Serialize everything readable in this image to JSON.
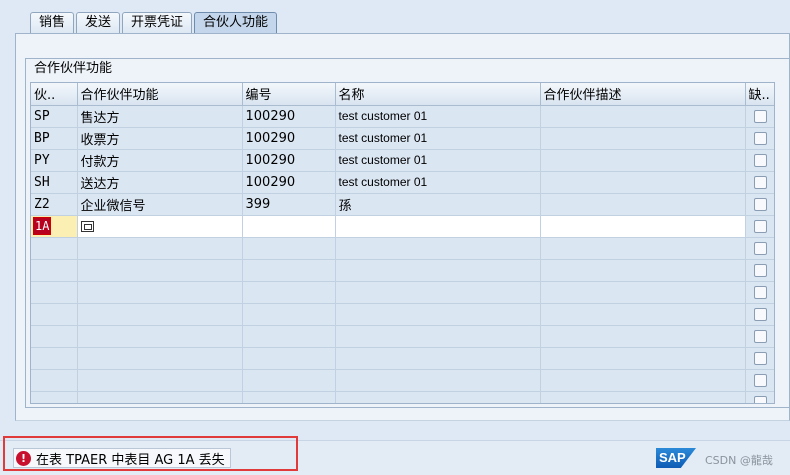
{
  "tabs": [
    {
      "label": "销售"
    },
    {
      "label": "发送"
    },
    {
      "label": "开票凭证"
    },
    {
      "label": "合伙人功能"
    }
  ],
  "group": {
    "title": "合作伙伴功能"
  },
  "table": {
    "headers": [
      "伙..",
      "合作伙伴功能",
      "编号",
      "名称",
      "合作伙伴描述",
      "缺.."
    ],
    "rows": [
      {
        "code": "SP",
        "function": "售达方",
        "number": "100290",
        "name": "test customer 01",
        "desc": ""
      },
      {
        "code": "BP",
        "function": "收票方",
        "number": "100290",
        "name": "test customer 01",
        "desc": ""
      },
      {
        "code": "PY",
        "function": "付款方",
        "number": "100290",
        "name": "test customer 01",
        "desc": ""
      },
      {
        "code": "SH",
        "function": "送达方",
        "number": "100290",
        "name": "test customer 01",
        "desc": ""
      },
      {
        "code": "Z2",
        "function": "企业微信号",
        "number": "399",
        "name": "孫",
        "desc": ""
      }
    ],
    "edit_row": {
      "code": "1A",
      "function": "",
      "number": "",
      "name": "",
      "desc": ""
    }
  },
  "status": {
    "message": "在表 TPAER 中表目 AG 1A  丢失",
    "icon": "error-icon"
  },
  "brand": {
    "logo": "SAP",
    "watermark": "CSDN @龍哉"
  }
}
